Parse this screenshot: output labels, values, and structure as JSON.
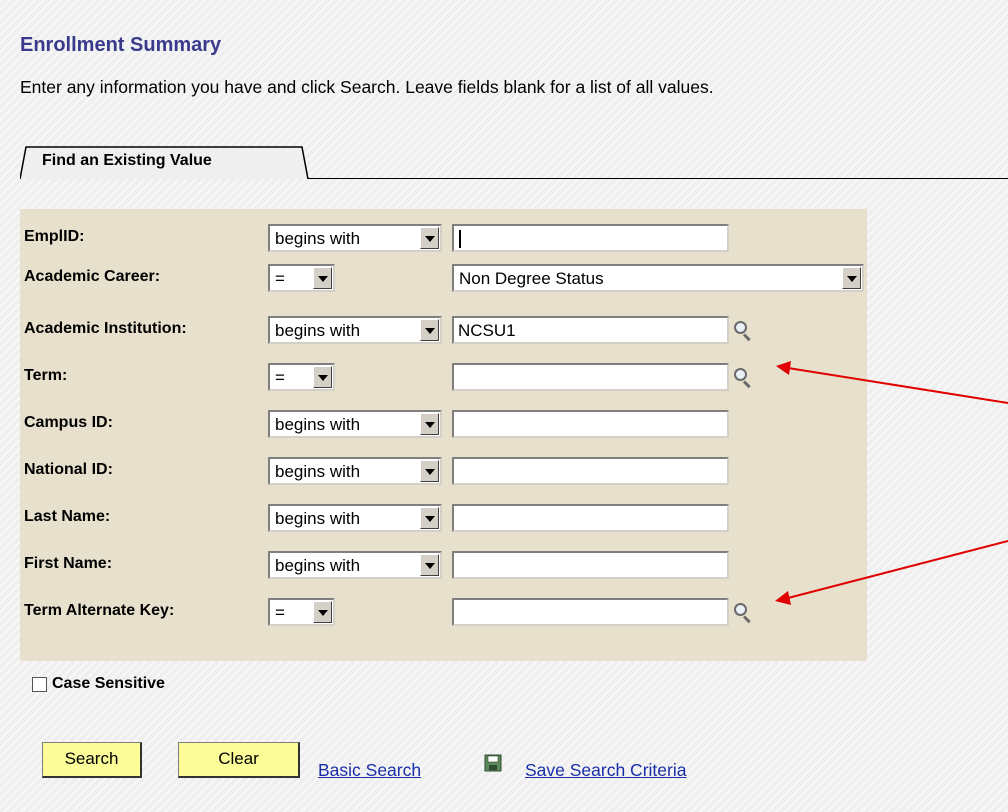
{
  "page": {
    "title": "Enrollment Summary",
    "instructions": "Enter any information you have and click Search. Leave fields blank for a list of all values."
  },
  "tab": {
    "label": "Find an Existing Value"
  },
  "fields": [
    {
      "label": "EmplID:",
      "operator": "begins with",
      "value": "",
      "has_lookup": false
    },
    {
      "label": "Academic Career:",
      "operator": "=",
      "value": "Non Degree Status",
      "has_lookup": false
    },
    {
      "label": "Academic Institution:",
      "operator": "begins with",
      "value": "NCSU1",
      "has_lookup": true
    },
    {
      "label": "Term:",
      "operator": "=",
      "value": "",
      "has_lookup": true
    },
    {
      "label": "Campus ID:",
      "operator": "begins with",
      "value": "",
      "has_lookup": false
    },
    {
      "label": "National ID:",
      "operator": "begins with",
      "value": "",
      "has_lookup": false
    },
    {
      "label": "Last Name:",
      "operator": "begins with",
      "value": "",
      "has_lookup": false
    },
    {
      "label": "First Name:",
      "operator": "begins with",
      "value": "",
      "has_lookup": false
    },
    {
      "label": "Term Alternate Key:",
      "operator": "=",
      "value": "",
      "has_lookup": true
    }
  ],
  "case_sensitive": {
    "label": "Case Sensitive",
    "checked": false
  },
  "buttons": {
    "search": "Search",
    "clear": "Clear"
  },
  "links": {
    "basic_search": "Basic Search",
    "save_criteria": "Save Search Criteria"
  },
  "icons": {
    "lookup": "magnifier-icon",
    "save": "floppy-disk-icon",
    "dropdown": "chevron-down-icon"
  },
  "colors": {
    "title": "#3a3a8c",
    "panel": "#e6e0cd",
    "button": "#fcfc99",
    "link": "#1a2ea8",
    "annotation_arrow": "#e00000"
  }
}
